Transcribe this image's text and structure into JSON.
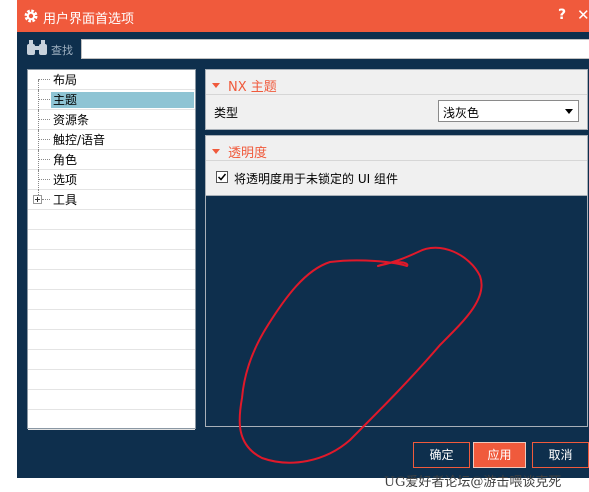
{
  "window": {
    "title": "用户界面首选项",
    "help": "?",
    "close": "✕"
  },
  "search": {
    "label": "查找",
    "value": ""
  },
  "tree": {
    "items": [
      {
        "label": "布局"
      },
      {
        "label": "主题",
        "selected": true
      },
      {
        "label": "资源条"
      },
      {
        "label": "触控/语音"
      },
      {
        "label": "角色"
      },
      {
        "label": "选项"
      },
      {
        "label": "工具",
        "expandable": true
      }
    ]
  },
  "theme_section": {
    "heading": "NX 主题",
    "type_label": "类型",
    "type_value": "浅灰色"
  },
  "transparency_section": {
    "heading": "透明度",
    "checkbox_label": "将透明度用于未锁定的 UI 组件",
    "checked": true
  },
  "buttons": {
    "ok": "确定",
    "apply": "应用",
    "cancel": "取消"
  },
  "watermark": "UG爱好者论坛@游击喂谈克死",
  "colors": {
    "accent": "#f05a3c",
    "dialog_bg": "#0e2f4d",
    "selection": "#8ec4d4",
    "annotation": "#e0192a"
  }
}
